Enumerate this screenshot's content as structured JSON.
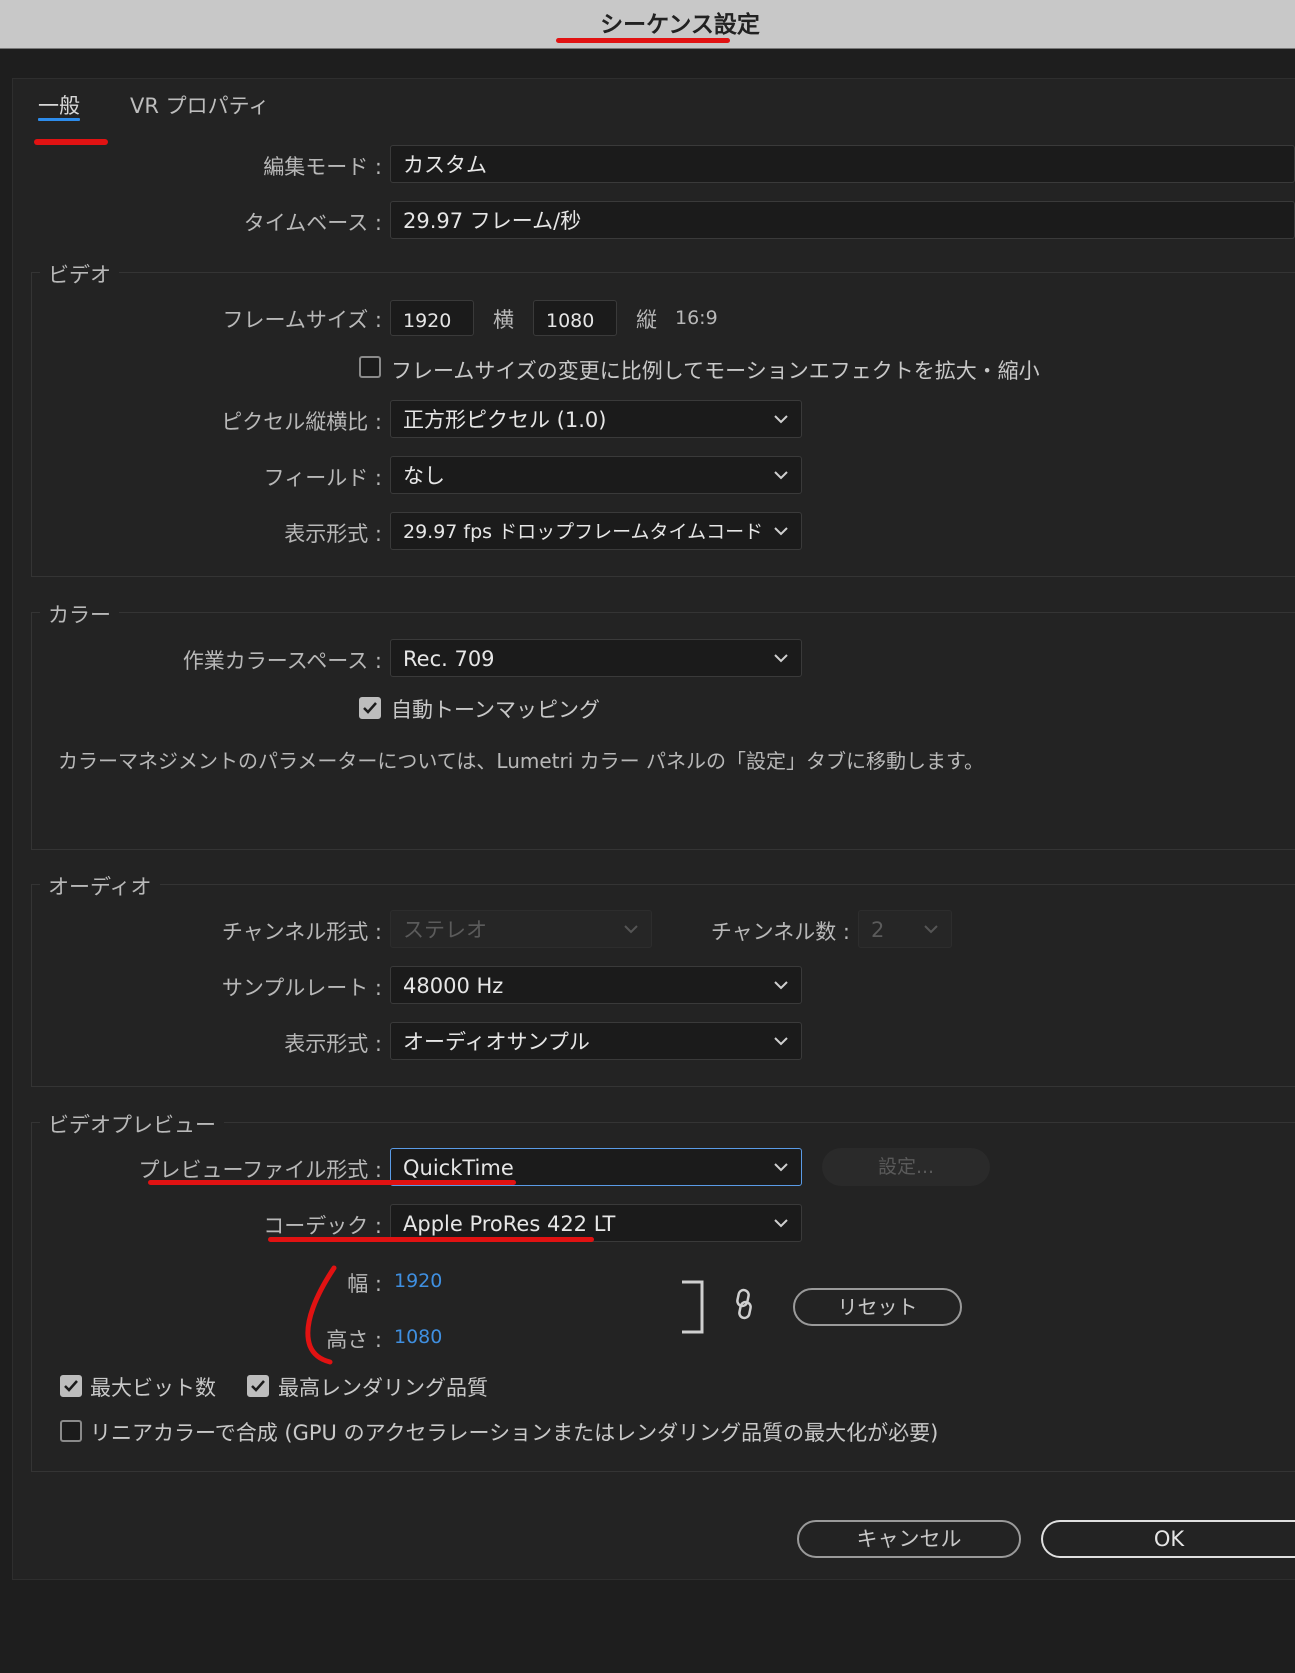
{
  "window": {
    "title": "シーケンス設定"
  },
  "tabs": [
    {
      "label": "一般",
      "active": true
    },
    {
      "label": "VR プロパティ",
      "active": false
    }
  ],
  "general": {
    "edit_mode_label": "編集モード :",
    "edit_mode_value": "カスタム",
    "timebase_label": "タイムベース :",
    "timebase_value": "29.97  フレーム/秒"
  },
  "video": {
    "legend": "ビデオ",
    "frame_size_label": "フレームサイズ :",
    "frame_width": "1920",
    "horizontal_label": "横",
    "frame_height": "1080",
    "vertical_label": "縦",
    "aspect_ratio": "16:9",
    "scale_motion_label": "フレームサイズの変更に比例してモーションエフェクトを拡大・縮小",
    "scale_motion_checked": false,
    "pixel_aspect_label": "ピクセル縦横比 :",
    "pixel_aspect_value": "正方形ピクセル (1.0)",
    "fields_label": "フィールド :",
    "fields_value": "なし",
    "display_format_label": "表示形式 :",
    "display_format_value": "29.97 fps ドロップフレームタイムコード"
  },
  "color": {
    "legend": "カラー",
    "working_space_label": "作業カラースペース :",
    "working_space_value": "Rec. 709",
    "auto_tone_label": "自動トーンマッピング",
    "auto_tone_checked": true,
    "note": "カラーマネジメントのパラメーターについては、Lumetri カラー パネルの「設定」タブに移動します。"
  },
  "audio": {
    "legend": "オーディオ",
    "channel_format_label": "チャンネル形式 :",
    "channel_format_value": "ステレオ",
    "channel_count_label": "チャンネル数 :",
    "channel_count_value": "2",
    "sample_rate_label": "サンプルレート :",
    "sample_rate_value": "48000 Hz",
    "display_format_label": "表示形式 :",
    "display_format_value": "オーディオサンプル"
  },
  "video_preview": {
    "legend": "ビデオプレビュー",
    "file_format_label": "プレビューファイル形式 :",
    "file_format_value": "QuickTime",
    "settings_button": "設定...",
    "codec_label": "コーデック :",
    "codec_value": "Apple ProRes 422 LT",
    "width_label": "幅 :",
    "width_value": "1920",
    "height_label": "高さ :",
    "height_value": "1080",
    "reset_button": "リセット",
    "max_bit_depth_label": "最大ビット数",
    "max_bit_depth_checked": true,
    "max_render_quality_label": "最高レンダリング品質",
    "max_render_quality_checked": true,
    "linear_color_label": "リニアカラーで合成 (GPU のアクセラレーションまたはレンダリング品質の最大化が必要)",
    "linear_color_checked": false
  },
  "footer": {
    "cancel_button": "キャンセル",
    "ok_button": "OK"
  },
  "colors": {
    "accent": "#2d8ceb",
    "annotation": "#e11212",
    "link_value": "#3f8fe0"
  }
}
